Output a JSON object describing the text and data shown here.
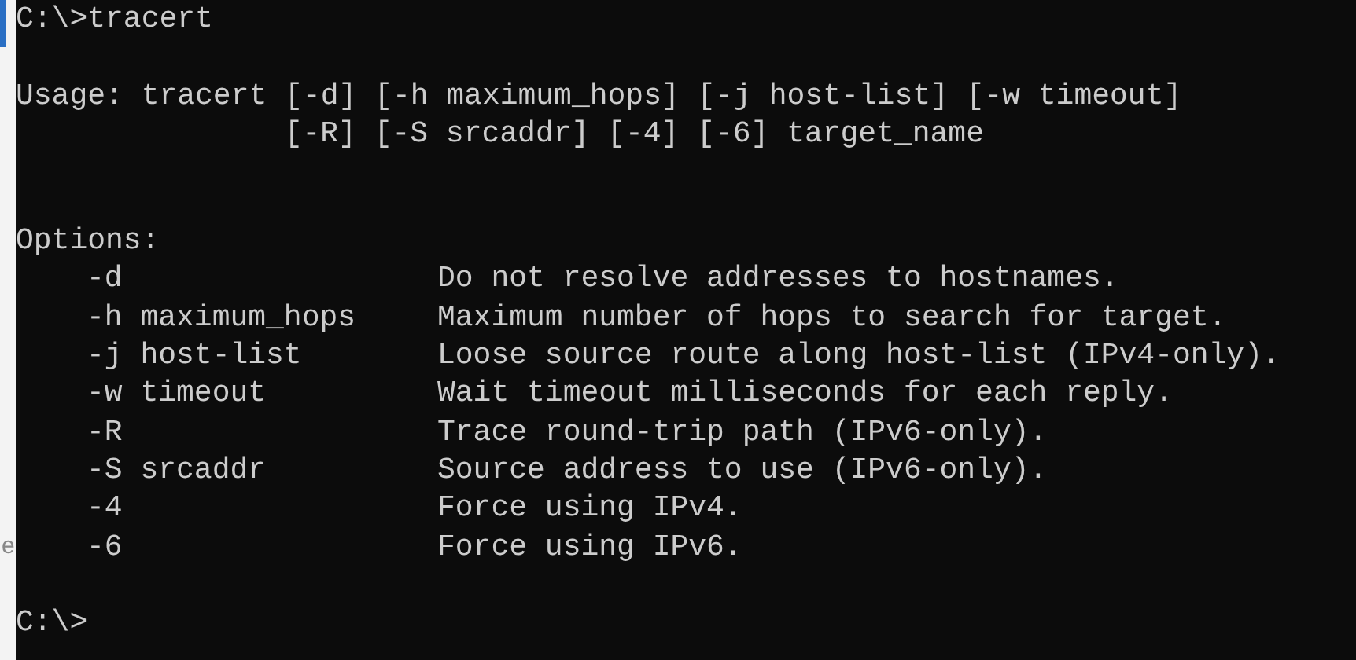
{
  "background_window": {
    "text_fragment": "e"
  },
  "console": {
    "command_line": "C:\\>tracert",
    "usage": {
      "label": "Usage:",
      "lines": [
        "tracert [-d] [-h maximum_hops] [-j host-list] [-w timeout]",
        "[-R] [-S srcaddr] [-4] [-6] target_name"
      ]
    },
    "options_heading": "Options:",
    "options": [
      {
        "flag": "-d",
        "description": "Do not resolve addresses to hostnames."
      },
      {
        "flag": "-h maximum_hops",
        "description": "Maximum number of hops to search for target."
      },
      {
        "flag": "-j host-list",
        "description": "Loose source route along host-list (IPv4-only)."
      },
      {
        "flag": "-w timeout",
        "description": "Wait timeout milliseconds for each reply."
      },
      {
        "flag": "-R",
        "description": "Trace round-trip path (IPv6-only)."
      },
      {
        "flag": "-S srcaddr",
        "description": "Source address to use (IPv6-only)."
      },
      {
        "flag": "-4",
        "description": "Force using IPv4."
      },
      {
        "flag": "-6",
        "description": "Force using IPv6."
      }
    ],
    "prompt": "C:\\>"
  }
}
